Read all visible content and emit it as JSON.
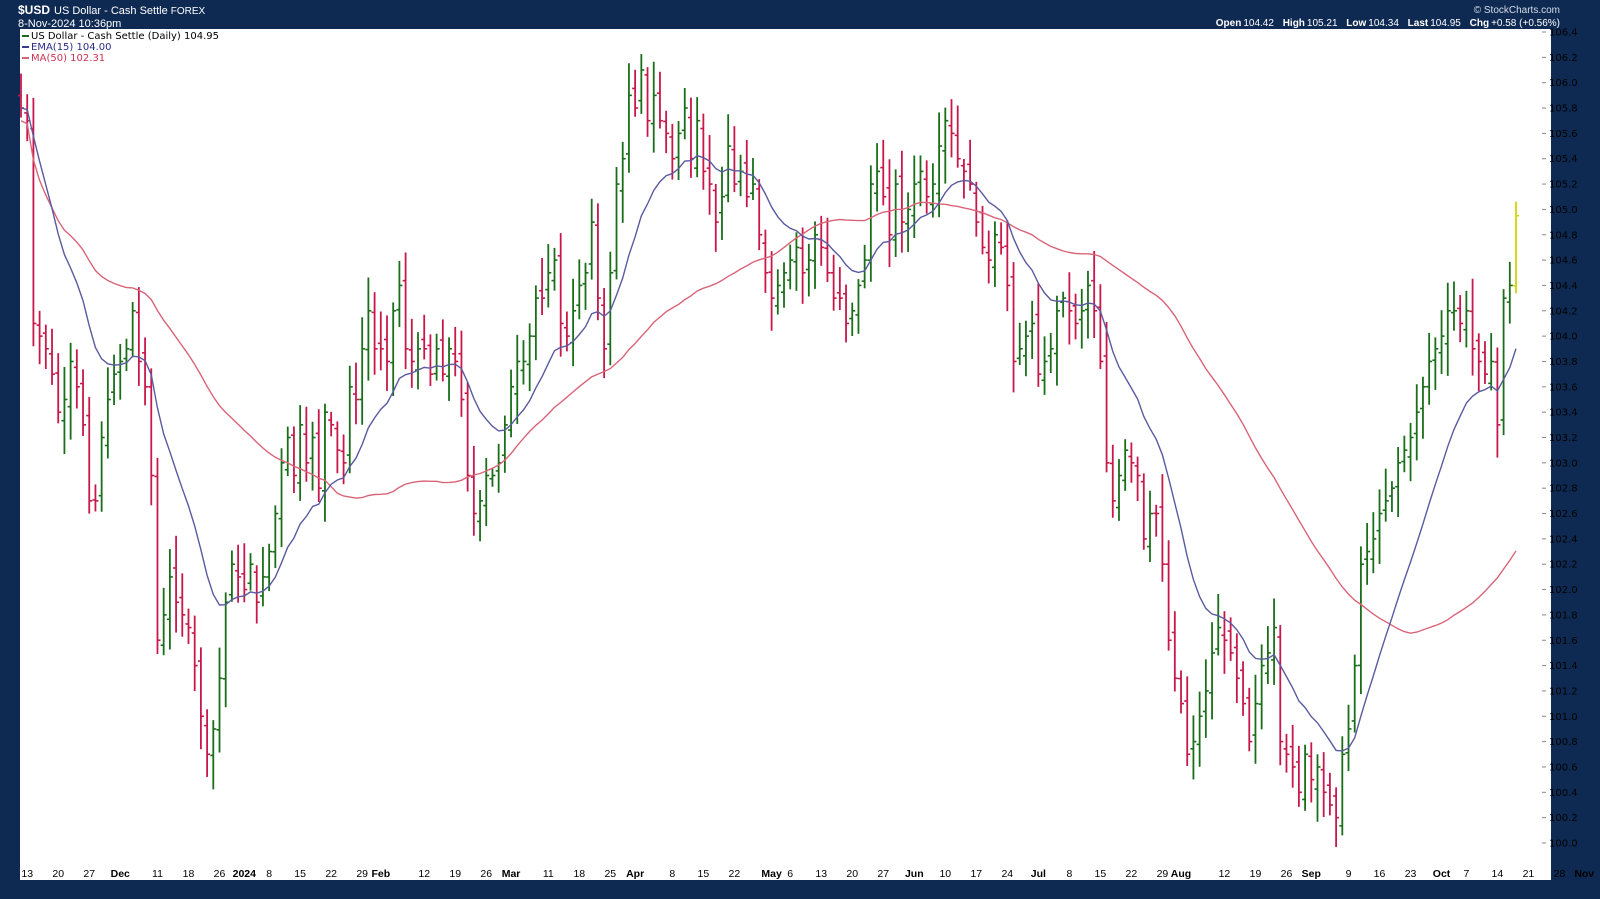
{
  "header": {
    "symbol": "$USD",
    "name": "US Dollar - Cash Settle",
    "exchange": "FOREX",
    "date": "8-Nov-2024 10:36pm",
    "brand": "© StockCharts.com",
    "open_label": "Open",
    "open": "104.42",
    "high_label": "High",
    "high": "105.21",
    "low_label": "Low",
    "low": "104.34",
    "last_label": "Last",
    "last": "104.95",
    "chg_label": "Chg",
    "chg": "+0.58 (+0.56%)"
  },
  "legend": {
    "price": "US Dollar - Cash Settle (Daily) 104.95",
    "ema": "EMA(15) 104.00",
    "ma": "MA(50) 102.31"
  },
  "colors": {
    "up": "#1a6e1a",
    "down": "#c8174a",
    "ema": "#5a5aa0",
    "ma": "#d96478",
    "last": "#d4d400",
    "frame": "#0e2a52",
    "plot_bg": "#ffffff"
  },
  "chart_data": {
    "type": "ohlc",
    "ylim": [
      99.9,
      106.45
    ],
    "yticks": [
      "106.4",
      "106.2",
      "106.0",
      "105.8",
      "105.6",
      "105.4",
      "105.2",
      "105.0",
      "104.8",
      "104.6",
      "104.4",
      "104.2",
      "104.0",
      "103.8",
      "103.6",
      "103.4",
      "103.2",
      "103.0",
      "102.8",
      "102.6",
      "102.4",
      "102.2",
      "102.0",
      "101.8",
      "101.6",
      "101.4",
      "101.2",
      "101.0",
      "100.8",
      "100.6",
      "100.4",
      "100.2",
      "100.0"
    ],
    "xticks": [
      {
        "label": "13",
        "i": 1
      },
      {
        "label": "20",
        "i": 6
      },
      {
        "label": "27",
        "i": 11
      },
      {
        "label": "Dec",
        "i": 16,
        "bold": true
      },
      {
        "label": "11",
        "i": 22
      },
      {
        "label": "18",
        "i": 27
      },
      {
        "label": "26",
        "i": 32
      },
      {
        "label": "2024",
        "i": 36,
        "bold": true
      },
      {
        "label": "8",
        "i": 40
      },
      {
        "label": "15",
        "i": 45
      },
      {
        "label": "22",
        "i": 50
      },
      {
        "label": "29",
        "i": 55
      },
      {
        "label": "Feb",
        "i": 58,
        "bold": true
      },
      {
        "label": "12",
        "i": 65
      },
      {
        "label": "19",
        "i": 70
      },
      {
        "label": "26",
        "i": 75
      },
      {
        "label": "Mar",
        "i": 79,
        "bold": true
      },
      {
        "label": "11",
        "i": 85
      },
      {
        "label": "18",
        "i": 90
      },
      {
        "label": "25",
        "i": 95
      },
      {
        "label": "Apr",
        "i": 99,
        "bold": true
      },
      {
        "label": "8",
        "i": 105
      },
      {
        "label": "15",
        "i": 110
      },
      {
        "label": "22",
        "i": 115
      },
      {
        "label": "May",
        "i": 121,
        "bold": true
      },
      {
        "label": "6",
        "i": 124
      },
      {
        "label": "13",
        "i": 129
      },
      {
        "label": "20",
        "i": 134
      },
      {
        "label": "27",
        "i": 139
      },
      {
        "label": "Jun",
        "i": 144,
        "bold": true
      },
      {
        "label": "10",
        "i": 149
      },
      {
        "label": "17",
        "i": 154
      },
      {
        "label": "24",
        "i": 159
      },
      {
        "label": "Jul",
        "i": 164,
        "bold": true
      },
      {
        "label": "8",
        "i": 169
      },
      {
        "label": "15",
        "i": 174
      },
      {
        "label": "22",
        "i": 179
      },
      {
        "label": "29",
        "i": 184
      },
      {
        "label": "Aug",
        "i": 187,
        "bold": true
      },
      {
        "label": "12",
        "i": 194
      },
      {
        "label": "19",
        "i": 199
      },
      {
        "label": "26",
        "i": 204
      },
      {
        "label": "Sep",
        "i": 208,
        "bold": true
      },
      {
        "label": "9",
        "i": 214
      },
      {
        "label": "16",
        "i": 219
      },
      {
        "label": "23",
        "i": 224
      },
      {
        "label": "Oct",
        "i": 229,
        "bold": true
      },
      {
        "label": "7",
        "i": 233
      },
      {
        "label": "14",
        "i": 238
      },
      {
        "label": "21",
        "i": 243
      },
      {
        "label": "28",
        "i": 248
      },
      {
        "label": "Nov",
        "i": 252,
        "bold": true
      }
    ],
    "closes": [
      105.8,
      105.7,
      104.1,
      104.0,
      103.9,
      103.7,
      103.4,
      103.5,
      103.8,
      103.6,
      103.3,
      102.7,
      102.7,
      103.2,
      103.5,
      103.7,
      103.8,
      103.9,
      104.2,
      103.8,
      103.6,
      102.9,
      101.6,
      101.8,
      102.1,
      101.9,
      101.8,
      101.7,
      101.4,
      101.0,
      100.7,
      100.9,
      101.3,
      101.9,
      102.2,
      102.1,
      102.0,
      102.2,
      101.9,
      102.1,
      102.3,
      102.6,
      103.0,
      103.2,
      102.9,
      103.3,
      103.0,
      103.2,
      102.8,
      103.4,
      103.3,
      103.1,
      103.0,
      103.6,
      103.5,
      103.9,
      104.2,
      103.9,
      103.9,
      103.8,
      104.2,
      104.4,
      103.9,
      103.8,
      103.9,
      103.9,
      103.7,
      103.9,
      103.7,
      103.9,
      103.8,
      103.5,
      102.9,
      102.6,
      102.7,
      102.9,
      102.9,
      103.0,
      103.3,
      103.6,
      103.8,
      103.8,
      104.0,
      104.3,
      104.3,
      104.5,
      104.6,
      104.1,
      104.0,
      104.2,
      104.4,
      104.5,
      104.9,
      104.3,
      103.9,
      104.5,
      105.2,
      105.4,
      105.9,
      105.8,
      106.1,
      105.7,
      105.9,
      105.7,
      105.6,
      105.4,
      105.6,
      105.8,
      105.4,
      105.7,
      105.3,
      105.2,
      104.9,
      105.1,
      105.5,
      105.2,
      105.3,
      105.1,
      105.2,
      104.8,
      104.5,
      104.3,
      104.4,
      104.5,
      104.6,
      104.7,
      104.5,
      104.6,
      104.8,
      104.7,
      104.5,
      104.3,
      104.3,
      104.1,
      104.2,
      104.4,
      104.6,
      105.2,
      105.3,
      105.1,
      104.8,
      105.2,
      104.9,
      105.0,
      105.2,
      105.3,
      105.1,
      105.2,
      105.5,
      105.7,
      105.6,
      105.4,
      105.3,
      105.2,
      104.9,
      104.7,
      104.6,
      104.8,
      104.7,
      104.4,
      103.8,
      103.9,
      104.0,
      104.1,
      103.7,
      103.8,
      103.9,
      104.2,
      104.3,
      104.2,
      104.1,
      104.2,
      104.4,
      104.2,
      103.8,
      103.0,
      102.7,
      102.9,
      103.1,
      103.0,
      102.9,
      102.4,
      102.6,
      102.6,
      102.2,
      101.6,
      101.3,
      101.1,
      100.7,
      100.8,
      101.0,
      101.2,
      101.5,
      101.7,
      101.6,
      101.5,
      101.3,
      101.1,
      100.8,
      101.1,
      101.4,
      101.5,
      101.7,
      100.8,
      100.7,
      100.6,
      100.4,
      100.7,
      100.5,
      100.6,
      100.4,
      100.3,
      100.2,
      100.7,
      100.9,
      101.4,
      102.2,
      102.3,
      102.4,
      102.6,
      102.7,
      102.8,
      103.0,
      103.1,
      103.2,
      103.4,
      103.6,
      103.8,
      103.9,
      104.0,
      104.2,
      104.2,
      104.1,
      104.2,
      103.9,
      103.8,
      103.7,
      103.8,
      103.3,
      104.3,
      104.4,
      104.95
    ]
  }
}
